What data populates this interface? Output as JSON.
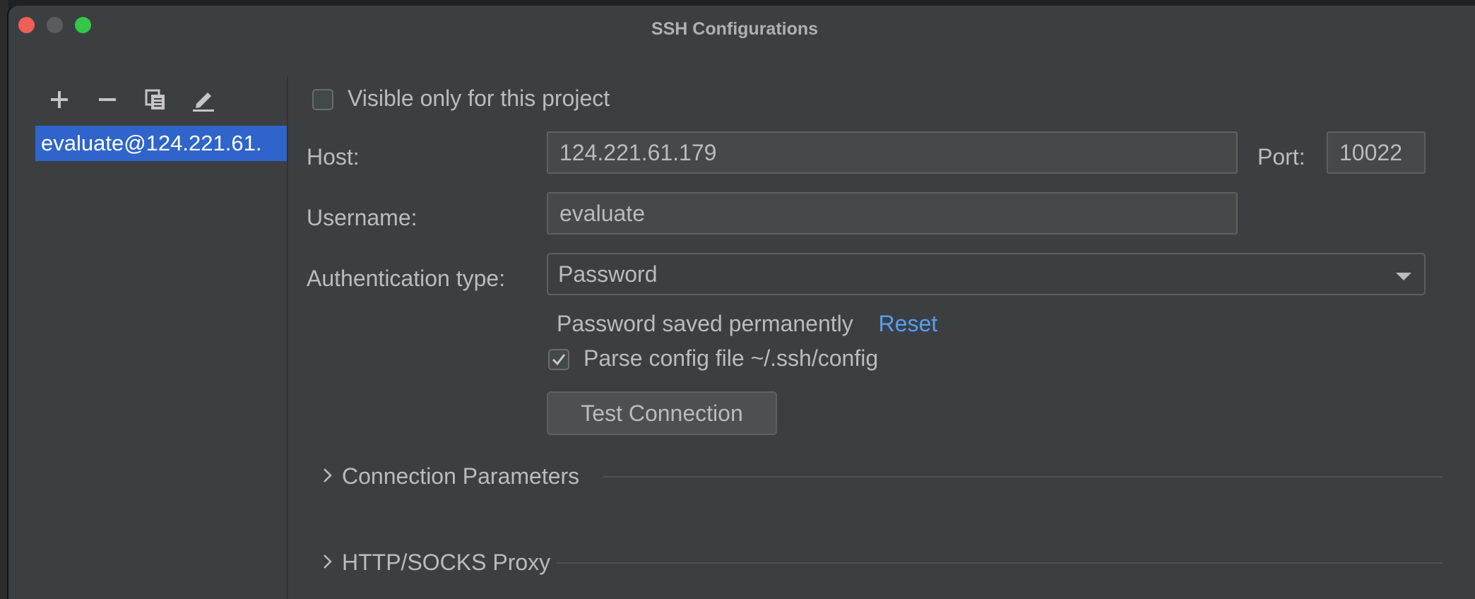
{
  "window": {
    "title": "SSH Configurations"
  },
  "toolbar": {
    "icons": [
      "plus-icon",
      "minus-icon",
      "copy-icon",
      "edit-icon"
    ]
  },
  "configs": [
    {
      "label": "evaluate@124.221.61.",
      "selected": true
    }
  ],
  "form": {
    "visible_only_label": "Visible only for this project",
    "visible_only_checked": false,
    "host_label": "Host:",
    "host_value": "124.221.61.179",
    "port_label": "Port:",
    "port_value": "10022",
    "username_label": "Username:",
    "username_value": "evaluate",
    "auth_label": "Authentication type:",
    "auth_value": "Password",
    "password_status": "Password saved permanently",
    "reset_link": "Reset",
    "parse_config_label": "Parse config file ~/.ssh/config",
    "parse_config_checked": true,
    "test_button": "Test Connection"
  },
  "sections": [
    {
      "title": "Connection Parameters",
      "collapsed": true
    },
    {
      "title": "HTTP/SOCKS Proxy",
      "collapsed": true
    }
  ],
  "colors": {
    "selection": "#2f65ca",
    "link": "#589df6",
    "background": "#3c3f41"
  }
}
